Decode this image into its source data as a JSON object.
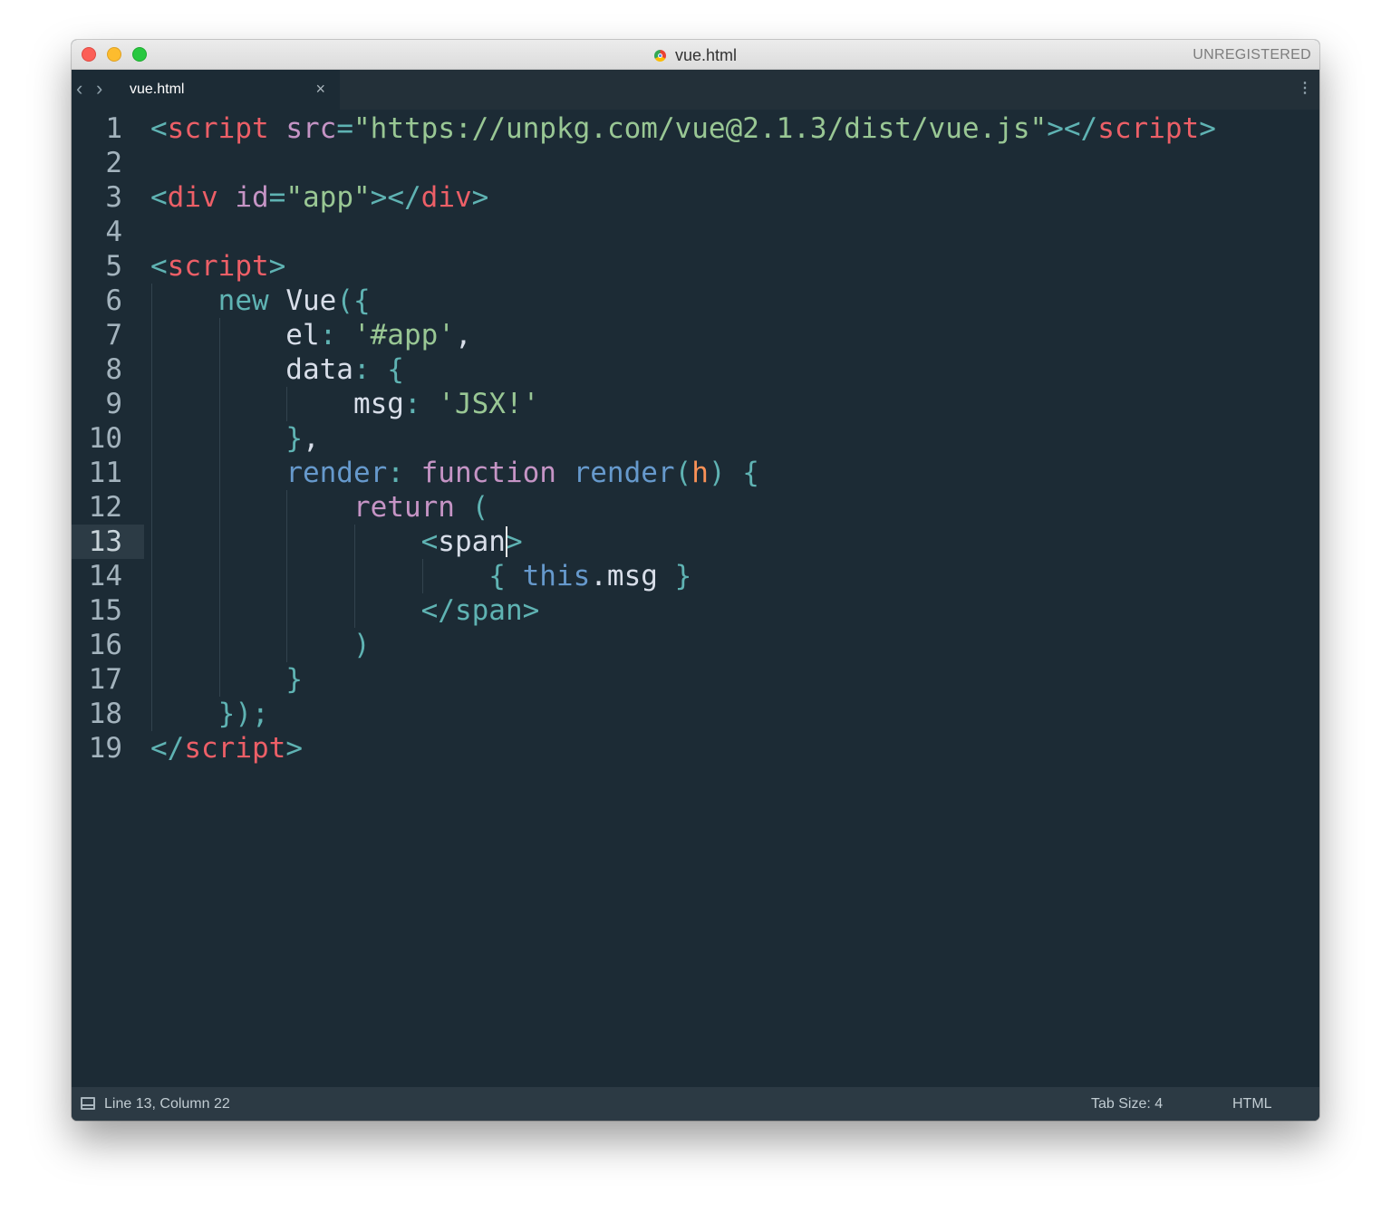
{
  "window": {
    "title": "vue.html",
    "registration": "UNREGISTERED",
    "colors": {
      "background": "#1c2b35",
      "tag": "#ec5f67",
      "punctuation": "#5fb3b3",
      "string": "#99c794",
      "function": "#6699cc",
      "keyword": "#c594c5"
    }
  },
  "tabs": [
    {
      "label": "vue.html",
      "close_glyph": "×",
      "active": true
    }
  ],
  "nav": {
    "back_glyph": "‹",
    "forward_glyph": "›",
    "menu_glyph": "⋮"
  },
  "editor": {
    "active_line": 13,
    "line_numbers": [
      "1",
      "2",
      "3",
      "4",
      "5",
      "6",
      "7",
      "8",
      "9",
      "10",
      "11",
      "12",
      "13",
      "14",
      "15",
      "16",
      "17",
      "18",
      "19"
    ],
    "lines": [
      [
        [
          "c-punc",
          "<"
        ],
        [
          "c-tag",
          "script"
        ],
        [
          "c-plain",
          " "
        ],
        [
          "c-attr",
          "src"
        ],
        [
          "c-punc",
          "="
        ],
        [
          "c-str",
          "\"https://unpkg.com/vue@2.1.3/dist/vue.js\""
        ],
        [
          "c-punc",
          "></"
        ],
        [
          "c-tag",
          "script"
        ],
        [
          "c-punc",
          ">"
        ]
      ],
      [],
      [
        [
          "c-punc",
          "<"
        ],
        [
          "c-tag",
          "div"
        ],
        [
          "c-plain",
          " "
        ],
        [
          "c-attr",
          "id"
        ],
        [
          "c-punc",
          "="
        ],
        [
          "c-str",
          "\"app\""
        ],
        [
          "c-punc",
          "></"
        ],
        [
          "c-tag",
          "div"
        ],
        [
          "c-punc",
          ">"
        ]
      ],
      [],
      [
        [
          "c-punc",
          "<"
        ],
        [
          "c-tag",
          "script"
        ],
        [
          "c-punc",
          ">"
        ]
      ],
      [
        [
          "c-plain",
          "    "
        ],
        [
          "c-kw",
          "new"
        ],
        [
          "c-plain",
          " Vue"
        ],
        [
          "c-punc",
          "({"
        ]
      ],
      [
        [
          "c-plain",
          "        el"
        ],
        [
          "c-punc",
          ": "
        ],
        [
          "c-str",
          "'#app'"
        ],
        [
          "c-plain",
          ","
        ]
      ],
      [
        [
          "c-plain",
          "        data"
        ],
        [
          "c-punc",
          ": {"
        ]
      ],
      [
        [
          "c-plain",
          "            msg"
        ],
        [
          "c-punc",
          ": "
        ],
        [
          "c-str",
          "'JSX!'"
        ]
      ],
      [
        [
          "c-plain",
          "        "
        ],
        [
          "c-punc",
          "}"
        ],
        [
          "c-plain",
          ","
        ]
      ],
      [
        [
          "c-plain",
          "        "
        ],
        [
          "c-func",
          "render"
        ],
        [
          "c-punc",
          ": "
        ],
        [
          "c-purp",
          "function"
        ],
        [
          "c-plain",
          " "
        ],
        [
          "c-func",
          "render"
        ],
        [
          "c-punc",
          "("
        ],
        [
          "c-param",
          "h"
        ],
        [
          "c-punc",
          ") {"
        ]
      ],
      [
        [
          "c-plain",
          "            "
        ],
        [
          "c-purp",
          "return"
        ],
        [
          "c-plain",
          " "
        ],
        [
          "c-punc",
          "("
        ]
      ],
      [
        [
          "c-plain",
          "                "
        ],
        [
          "c-punc",
          "<"
        ],
        [
          "c-plain",
          "span"
        ],
        [
          "c-punc",
          ">"
        ]
      ],
      [
        [
          "c-plain",
          "                    "
        ],
        [
          "c-punc",
          "{ "
        ],
        [
          "c-func",
          "this"
        ],
        [
          "c-plain",
          ".msg "
        ],
        [
          "c-punc",
          "}"
        ]
      ],
      [
        [
          "c-plain",
          "                "
        ],
        [
          "c-punc",
          "</span>"
        ]
      ],
      [
        [
          "c-plain",
          "            "
        ],
        [
          "c-punc",
          ")"
        ]
      ],
      [
        [
          "c-plain",
          "        "
        ],
        [
          "c-punc",
          "}"
        ]
      ],
      [
        [
          "c-plain",
          "    "
        ],
        [
          "c-punc",
          "});"
        ]
      ],
      [
        [
          "c-punc",
          "</"
        ],
        [
          "c-tag",
          "script"
        ],
        [
          "c-punc",
          ">"
        ]
      ]
    ]
  },
  "status": {
    "position": "Line 13, Column 22",
    "tab_size": "Tab Size: 4",
    "syntax": "HTML"
  }
}
